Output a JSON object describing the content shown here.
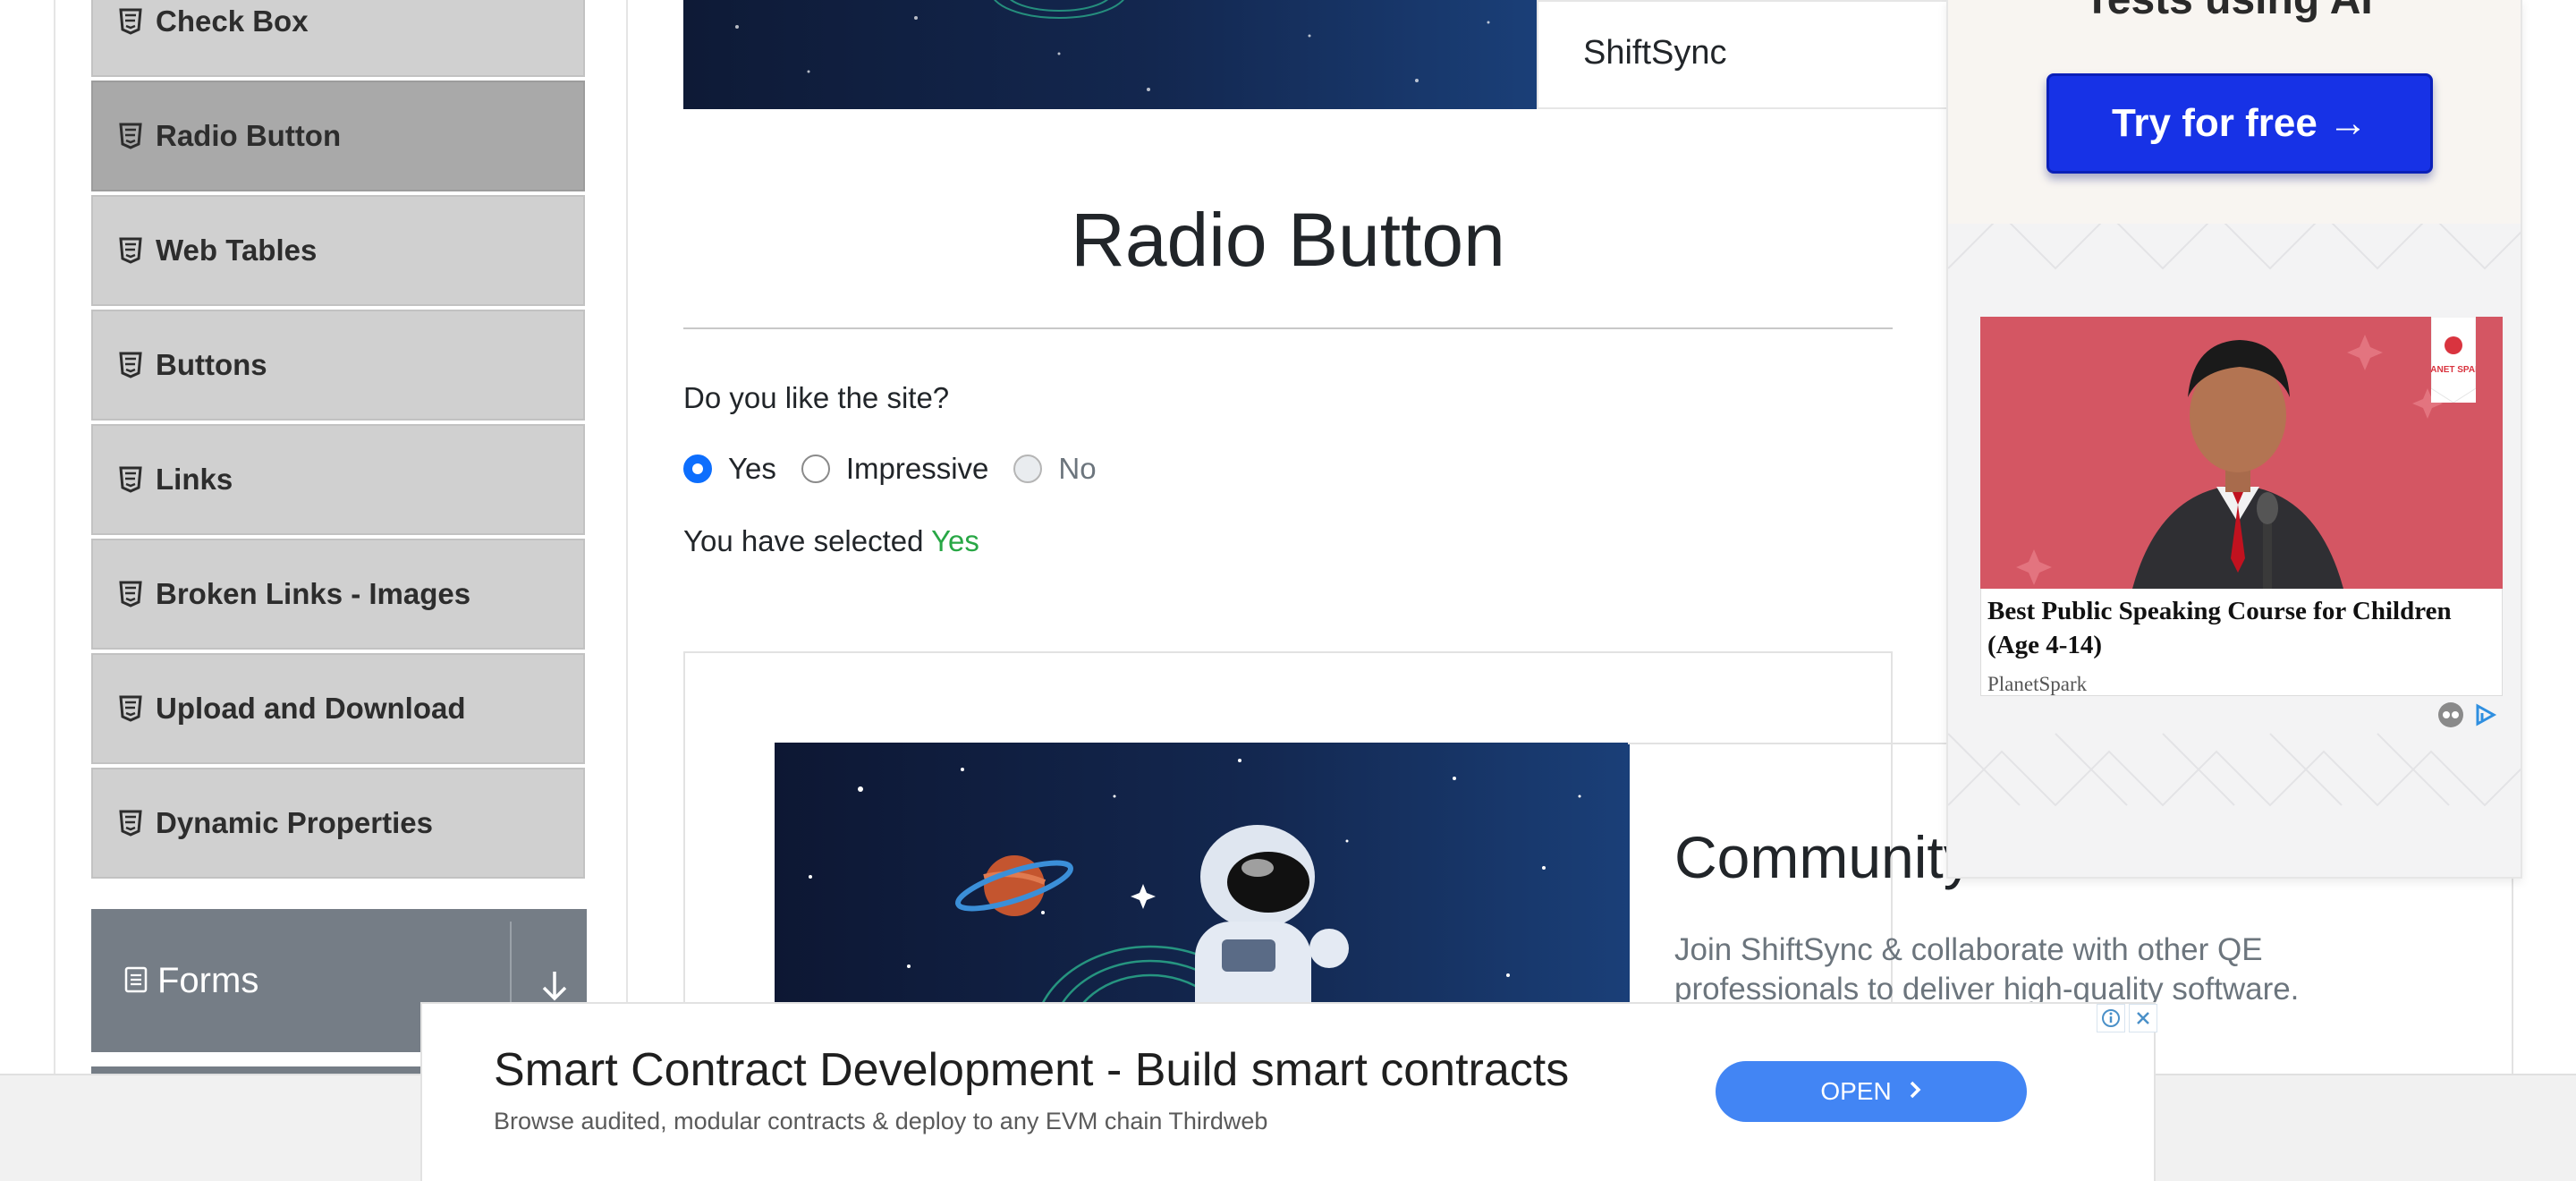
{
  "sidebar": {
    "items": [
      {
        "label": "Check Box",
        "active": false
      },
      {
        "label": "Radio Button",
        "active": true
      },
      {
        "label": "Web Tables",
        "active": false
      },
      {
        "label": "Buttons",
        "active": false
      },
      {
        "label": "Links",
        "active": false
      },
      {
        "label": "Broken Links - Images",
        "active": false
      },
      {
        "label": "Upload and Download",
        "active": false
      },
      {
        "label": "Dynamic Properties",
        "active": false
      }
    ],
    "forms_group": {
      "label": "Forms",
      "icon": "document-icon",
      "toggle_icon": "download-arrow-icon"
    }
  },
  "banner_top": {
    "brand": "ShiftSync"
  },
  "main": {
    "heading": "Radio Button",
    "question": "Do you like the site?",
    "options": [
      {
        "label": "Yes",
        "checked": true,
        "disabled": false
      },
      {
        "label": "Impressive",
        "checked": false,
        "disabled": false
      },
      {
        "label": "No",
        "checked": false,
        "disabled": true
      }
    ],
    "result_prefix": "You have selected",
    "result_value": "Yes",
    "result_color": "#28a745"
  },
  "community_banner": {
    "title": "Community",
    "description": "Join ShiftSync & collaborate with other QE professionals to deliver high-quality software."
  },
  "right_ad": {
    "cut_text": "Tests using AI",
    "button": "Try for free →",
    "card_title": "Best Public Speaking Course for Children (Age 4-14)",
    "card_source": "PlanetSpark",
    "card_tag": "PLANET SPARK"
  },
  "bottom_ad": {
    "title": "Smart Contract Development - Build smart contracts",
    "subtitle": "Browse audited, modular contracts & deploy to any EVM chain Thirdweb",
    "button": "OPEN"
  },
  "colors": {
    "accent": "#0d6efd",
    "sidebar_item_bg": "#d0d0d0",
    "sidebar_active_bg": "#a9a9a9",
    "forms_group_bg": "#757d86",
    "ad_button": "#1732e6",
    "open_button": "#4285f4"
  }
}
